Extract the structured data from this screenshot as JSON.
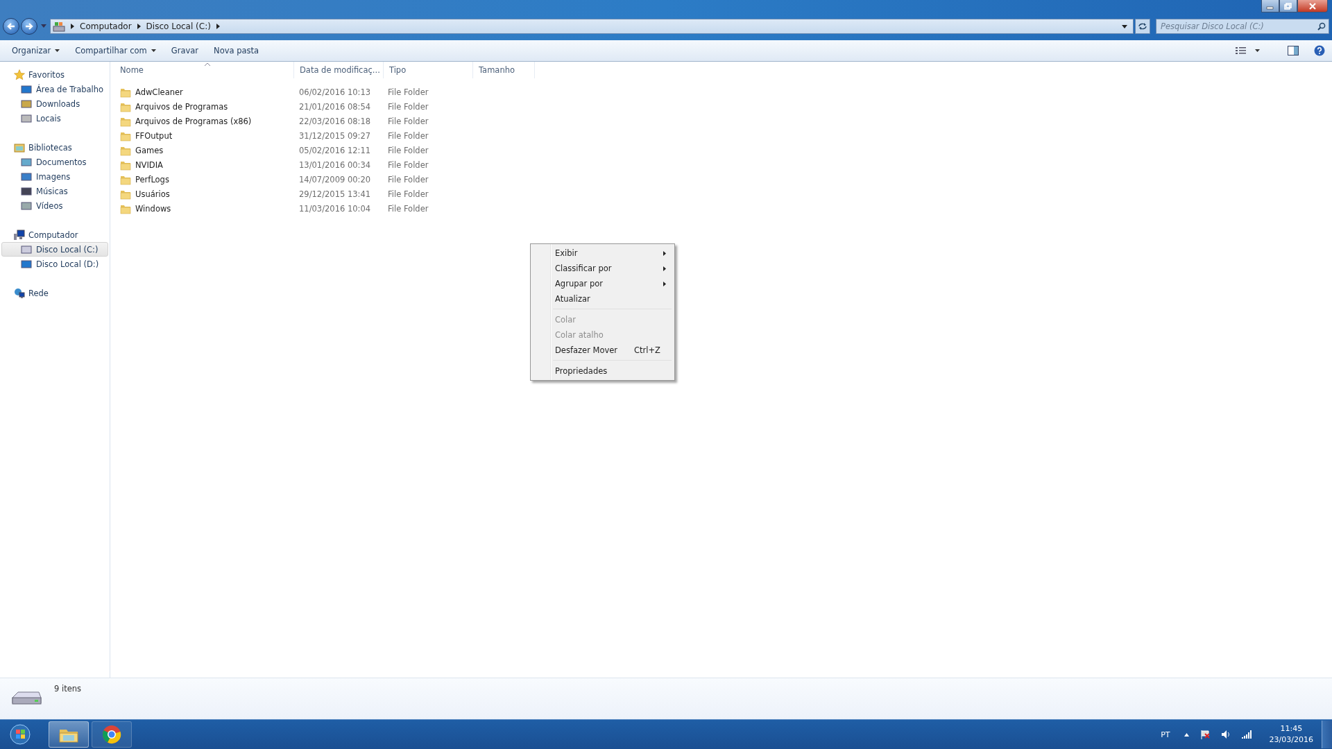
{
  "address_bar": {
    "path": [
      "Computador",
      "Disco Local (C:)"
    ]
  },
  "search": {
    "placeholder": "Pesquisar Disco Local (C:)"
  },
  "toolbar": {
    "buttons": [
      {
        "label": "Organizar",
        "dropdown": true
      },
      {
        "label": "Compartilhar com",
        "dropdown": true
      },
      {
        "label": "Gravar",
        "dropdown": false
      },
      {
        "label": "Nova pasta",
        "dropdown": false
      }
    ]
  },
  "sidebar": {
    "groups": [
      {
        "label": "Favoritos",
        "children": [
          {
            "label": "Área de Trabalho",
            "selected": false
          },
          {
            "label": "Downloads",
            "selected": false
          },
          {
            "label": "Locais",
            "selected": false
          }
        ]
      },
      {
        "label": "Bibliotecas",
        "children": [
          {
            "label": "Documentos",
            "selected": false
          },
          {
            "label": "Imagens",
            "selected": false
          },
          {
            "label": "Músicas",
            "selected": false
          },
          {
            "label": "Vídeos",
            "selected": false
          }
        ]
      },
      {
        "label": "Computador",
        "children": [
          {
            "label": "Disco Local (C:)",
            "selected": true
          },
          {
            "label": "Disco Local (D:)",
            "selected": false
          }
        ]
      },
      {
        "label": "Rede"
      }
    ]
  },
  "table": {
    "columns": [
      "Nome",
      "Data de modificaç...",
      "Tipo",
      "Tamanho"
    ],
    "rows": [
      {
        "name": "AdwCleaner",
        "date": "06/02/2016 10:13",
        "type": "File Folder"
      },
      {
        "name": "Arquivos de Programas",
        "date": "21/01/2016 08:54",
        "type": "File Folder"
      },
      {
        "name": "Arquivos de Programas (x86)",
        "date": "22/03/2016 08:18",
        "type": "File Folder"
      },
      {
        "name": "FFOutput",
        "date": "31/12/2015 09:27",
        "type": "File Folder"
      },
      {
        "name": "Games",
        "date": "05/02/2016 12:11",
        "type": "File Folder"
      },
      {
        "name": "NVIDIA",
        "date": "13/01/2016 00:34",
        "type": "File Folder"
      },
      {
        "name": "PerfLogs",
        "date": "14/07/2009 00:20",
        "type": "File Folder"
      },
      {
        "name": "Usuários",
        "date": "29/12/2015 13:41",
        "type": "File Folder"
      },
      {
        "name": "Windows",
        "date": "11/03/2016 10:04",
        "type": "File Folder"
      }
    ]
  },
  "context_menu": {
    "items": [
      {
        "label": "Exibir",
        "submenu": true,
        "disabled": false,
        "separator_before": false
      },
      {
        "label": "Classificar por",
        "submenu": true,
        "disabled": false,
        "separator_before": false
      },
      {
        "label": "Agrupar por",
        "submenu": true,
        "disabled": false,
        "separator_before": false
      },
      {
        "label": "Atualizar",
        "submenu": false,
        "disabled": false,
        "separator_before": false
      },
      {
        "label": "Colar",
        "submenu": false,
        "disabled": true,
        "separator_before": true
      },
      {
        "label": "Colar atalho",
        "submenu": false,
        "disabled": true,
        "separator_before": false
      },
      {
        "label": "Desfazer Mover",
        "shortcut": "Ctrl+Z",
        "submenu": false,
        "disabled": false,
        "separator_before": false
      },
      {
        "label": "Propriedades",
        "submenu": false,
        "disabled": false,
        "separator_before": true
      }
    ]
  },
  "status_bar": {
    "count": "9 itens"
  },
  "taskbar": {
    "apps": [
      {
        "selected": true
      },
      {
        "selected": false
      }
    ],
    "language": "PT",
    "time": "11:45",
    "date": "23/03/2016"
  }
}
